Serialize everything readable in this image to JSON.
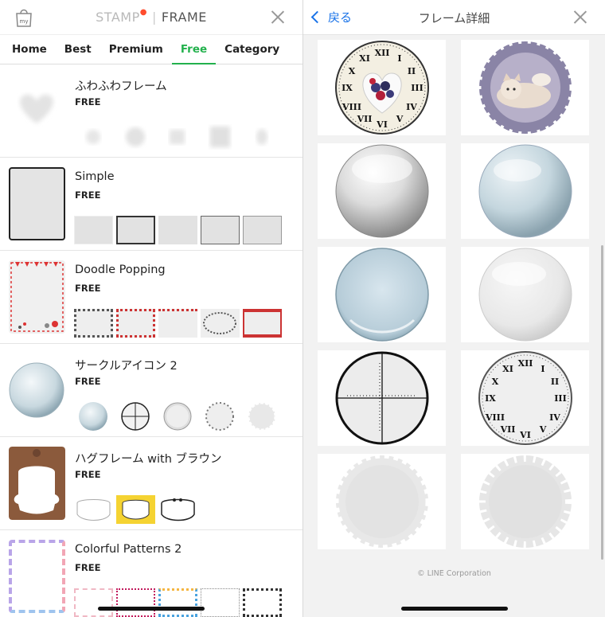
{
  "left": {
    "brand_stamp": "STAMP",
    "brand_sep": "|",
    "brand_frame": "FRAME",
    "tabs": [
      "Home",
      "Best",
      "Premium",
      "Free",
      "Category"
    ],
    "active_tab": "Free",
    "items": [
      {
        "title": "ふわふわフレーム",
        "price": "FREE"
      },
      {
        "title": "Simple",
        "price": "FREE"
      },
      {
        "title": "Doodle Popping",
        "price": "FREE"
      },
      {
        "title": "サークルアイコン 2",
        "price": "FREE"
      },
      {
        "title": "ハグフレーム with ブラウン",
        "price": "FREE"
      },
      {
        "title": "Colorful Patterns 2",
        "price": "FREE"
      }
    ]
  },
  "right": {
    "back_label": "戻る",
    "title": "フレーム詳細",
    "copyright": "© LINE Corporation"
  },
  "colors": {
    "accent_green": "#23b14d",
    "link_blue": "#1a73e8",
    "pane_bg": "#f2f2f2"
  },
  "icons": [
    "bag-icon",
    "close-icon",
    "back-chevron-icon"
  ]
}
